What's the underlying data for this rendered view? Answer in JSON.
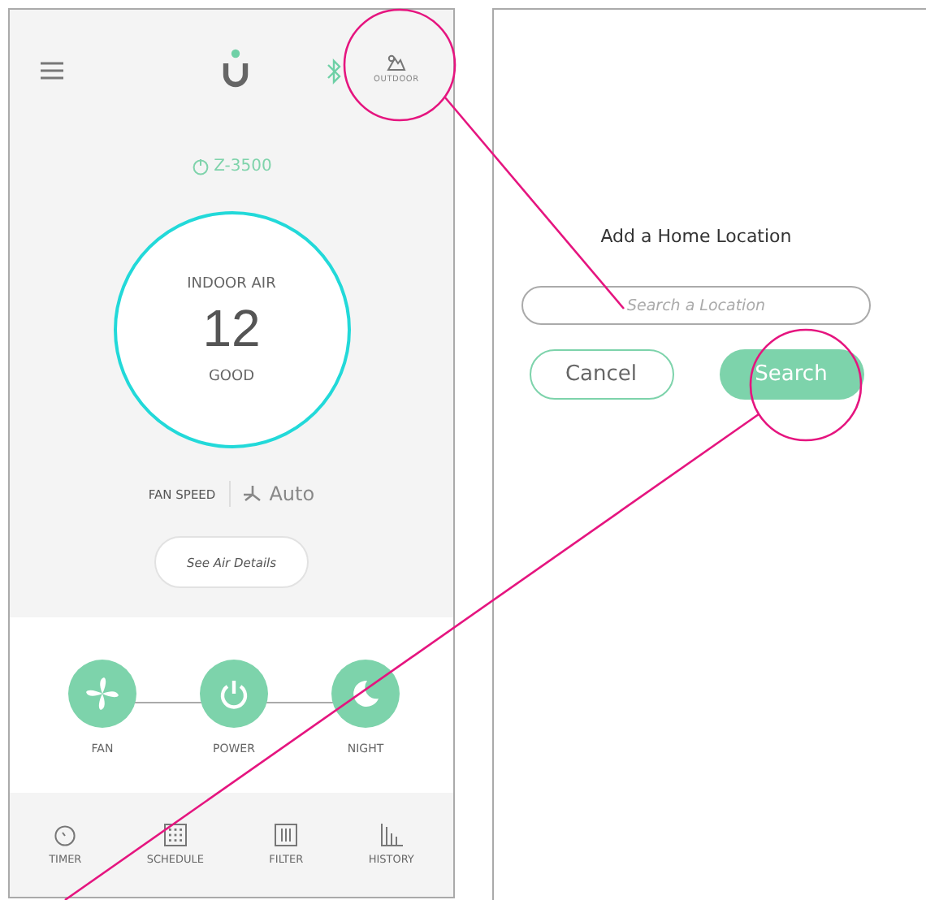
{
  "header": {
    "outdoor_label": "OUTDOOR"
  },
  "device": {
    "model": "Z-3500"
  },
  "air": {
    "title": "INDOOR AIR",
    "value": "12",
    "rating": "GOOD"
  },
  "fan_speed": {
    "label": "FAN SPEED",
    "value": "Auto"
  },
  "details_button": "See Air Details",
  "controls": [
    {
      "kind": "fan",
      "label": "FAN"
    },
    {
      "kind": "power",
      "label": "POWER"
    },
    {
      "kind": "night",
      "label": "NIGHT"
    }
  ],
  "tabs": [
    {
      "kind": "timer",
      "label": "TIMER"
    },
    {
      "kind": "schedule",
      "label": "SCHEDULE"
    },
    {
      "kind": "filter",
      "label": "FILTER"
    },
    {
      "kind": "history",
      "label": "HISTORY"
    }
  ],
  "dialog": {
    "title": "Add a Home Location",
    "search": {
      "placeholder": "Search a Location"
    },
    "buttons": [
      {
        "kind": "secondary",
        "label": "Cancel"
      },
      {
        "kind": "primary",
        "label": "Search"
      }
    ]
  }
}
